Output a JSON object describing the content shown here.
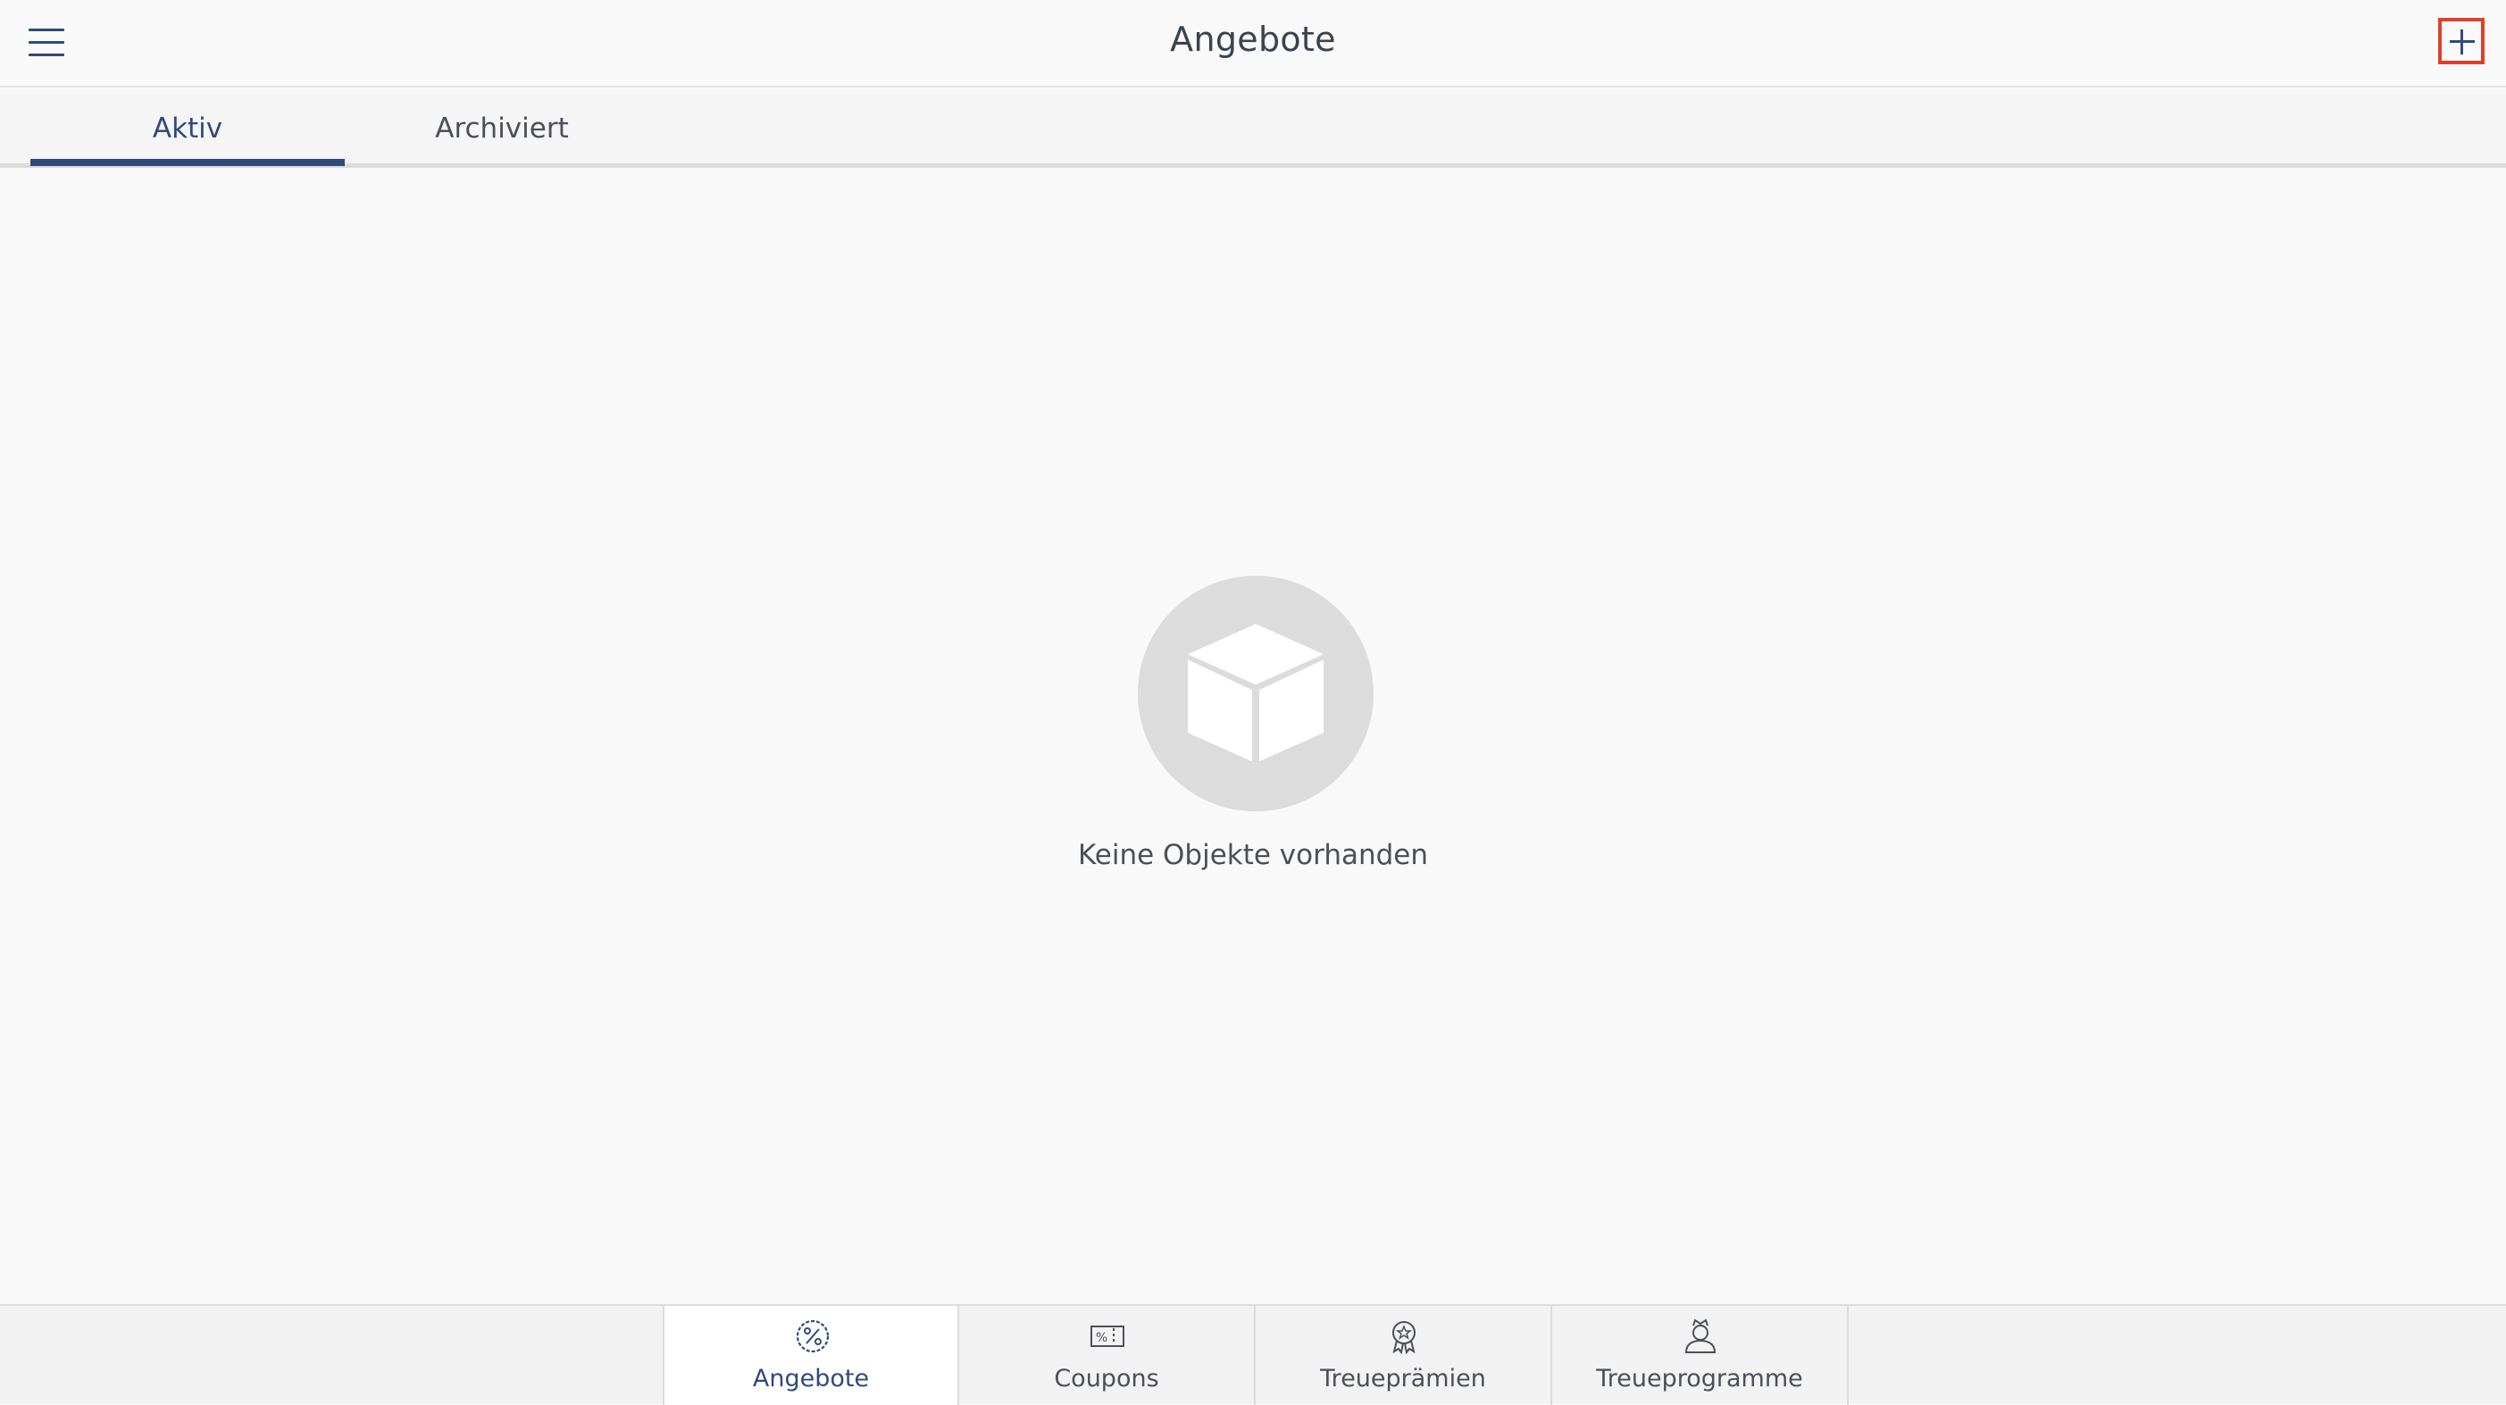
{
  "header": {
    "title": "Angebote",
    "menu_icon": "hamburger-menu-icon",
    "add_icon": "plus-icon",
    "highlight_color": "#e0402a"
  },
  "tabs": [
    {
      "label": "Aktiv",
      "active": true
    },
    {
      "label": "Archiviert",
      "active": false
    }
  ],
  "empty_state": {
    "icon": "box-icon",
    "text": "Keine Objekte vorhanden"
  },
  "bottom_nav": {
    "items": [
      {
        "label": "Angebote",
        "icon": "offer-percent-badge-icon",
        "selected": true
      },
      {
        "label": "Coupons",
        "icon": "coupon-ticket-icon",
        "selected": false
      },
      {
        "label": "Treueprämien",
        "icon": "award-ribbon-icon",
        "selected": false
      },
      {
        "label": "Treueprogramme",
        "icon": "person-crown-icon",
        "selected": false
      }
    ]
  },
  "colors": {
    "accent": "#304a7a",
    "background": "#f9f9f9",
    "text": "#3b4250"
  }
}
